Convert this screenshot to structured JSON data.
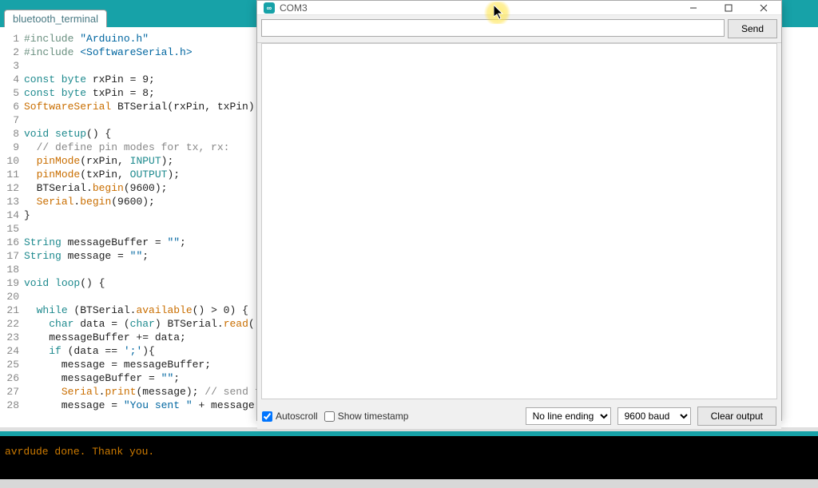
{
  "tab": {
    "name": "bluetooth_terminal"
  },
  "code": {
    "lines": [
      {
        "n": "1",
        "seg": [
          {
            "c": "tok-preproc",
            "t": "#include "
          },
          {
            "c": "tok-string",
            "t": "\"Arduino.h\""
          }
        ]
      },
      {
        "n": "2",
        "seg": [
          {
            "c": "tok-preproc",
            "t": "#include "
          },
          {
            "c": "tok-string",
            "t": "<SoftwareSerial.h>"
          }
        ]
      },
      {
        "n": "3",
        "seg": []
      },
      {
        "n": "4",
        "seg": [
          {
            "c": "tok-keyword",
            "t": "const byte"
          },
          {
            "c": "",
            "t": " rxPin = 9;"
          }
        ]
      },
      {
        "n": "5",
        "seg": [
          {
            "c": "tok-keyword",
            "t": "const byte"
          },
          {
            "c": "",
            "t": " txPin = 8;"
          }
        ]
      },
      {
        "n": "6",
        "seg": [
          {
            "c": "tok-orange",
            "t": "SoftwareSerial"
          },
          {
            "c": "",
            "t": " BTSerial(rxPin, txPin); //"
          }
        ]
      },
      {
        "n": "7",
        "seg": []
      },
      {
        "n": "8",
        "seg": [
          {
            "c": "tok-keyword",
            "t": "void "
          },
          {
            "c": "tok-keyword",
            "t": "setup"
          },
          {
            "c": "",
            "t": "() {"
          }
        ]
      },
      {
        "n": "9",
        "seg": [
          {
            "c": "",
            "t": "  "
          },
          {
            "c": "tok-comment",
            "t": "// define pin modes for tx, rx:"
          }
        ]
      },
      {
        "n": "10",
        "seg": [
          {
            "c": "",
            "t": "  "
          },
          {
            "c": "tok-orange",
            "t": "pinMode"
          },
          {
            "c": "",
            "t": "(rxPin, "
          },
          {
            "c": "tok-const",
            "t": "INPUT"
          },
          {
            "c": "",
            "t": ");"
          }
        ]
      },
      {
        "n": "11",
        "seg": [
          {
            "c": "",
            "t": "  "
          },
          {
            "c": "tok-orange",
            "t": "pinMode"
          },
          {
            "c": "",
            "t": "(txPin, "
          },
          {
            "c": "tok-const",
            "t": "OUTPUT"
          },
          {
            "c": "",
            "t": ");"
          }
        ]
      },
      {
        "n": "12",
        "seg": [
          {
            "c": "",
            "t": "  BTSerial."
          },
          {
            "c": "tok-orange",
            "t": "begin"
          },
          {
            "c": "",
            "t": "(9600);"
          }
        ]
      },
      {
        "n": "13",
        "seg": [
          {
            "c": "",
            "t": "  "
          },
          {
            "c": "tok-orange",
            "t": "Serial"
          },
          {
            "c": "",
            "t": "."
          },
          {
            "c": "tok-orange",
            "t": "begin"
          },
          {
            "c": "",
            "t": "(9600);"
          }
        ]
      },
      {
        "n": "14",
        "seg": [
          {
            "c": "",
            "t": "}"
          }
        ]
      },
      {
        "n": "15",
        "seg": []
      },
      {
        "n": "16",
        "seg": [
          {
            "c": "tok-keyword",
            "t": "String"
          },
          {
            "c": "",
            "t": " messageBuffer = "
          },
          {
            "c": "tok-string",
            "t": "\"\""
          },
          {
            "c": "",
            "t": ";"
          }
        ]
      },
      {
        "n": "17",
        "seg": [
          {
            "c": "tok-keyword",
            "t": "String"
          },
          {
            "c": "",
            "t": " message = "
          },
          {
            "c": "tok-string",
            "t": "\"\""
          },
          {
            "c": "",
            "t": ";"
          }
        ]
      },
      {
        "n": "18",
        "seg": []
      },
      {
        "n": "19",
        "seg": [
          {
            "c": "tok-keyword",
            "t": "void "
          },
          {
            "c": "tok-keyword",
            "t": "loop"
          },
          {
            "c": "",
            "t": "() {"
          }
        ]
      },
      {
        "n": "20",
        "seg": []
      },
      {
        "n": "21",
        "seg": [
          {
            "c": "",
            "t": "  "
          },
          {
            "c": "tok-keyword",
            "t": "while"
          },
          {
            "c": "",
            "t": " (BTSerial."
          },
          {
            "c": "tok-orange",
            "t": "available"
          },
          {
            "c": "",
            "t": "() > 0) {"
          }
        ]
      },
      {
        "n": "22",
        "seg": [
          {
            "c": "",
            "t": "    "
          },
          {
            "c": "tok-keyword",
            "t": "char"
          },
          {
            "c": "",
            "t": " data = ("
          },
          {
            "c": "tok-keyword",
            "t": "char"
          },
          {
            "c": "",
            "t": ") BTSerial."
          },
          {
            "c": "tok-orange",
            "t": "read"
          },
          {
            "c": "",
            "t": "();"
          }
        ]
      },
      {
        "n": "23",
        "seg": [
          {
            "c": "",
            "t": "    messageBuffer += data;"
          }
        ]
      },
      {
        "n": "24",
        "seg": [
          {
            "c": "",
            "t": "    "
          },
          {
            "c": "tok-keyword",
            "t": "if"
          },
          {
            "c": "",
            "t": " (data == "
          },
          {
            "c": "tok-string",
            "t": "';'"
          },
          {
            "c": "",
            "t": "){"
          }
        ]
      },
      {
        "n": "25",
        "seg": [
          {
            "c": "",
            "t": "      message = messageBuffer;"
          }
        ]
      },
      {
        "n": "26",
        "seg": [
          {
            "c": "",
            "t": "      messageBuffer = "
          },
          {
            "c": "tok-string",
            "t": "\"\""
          },
          {
            "c": "",
            "t": ";"
          }
        ]
      },
      {
        "n": "27",
        "seg": [
          {
            "c": "",
            "t": "      "
          },
          {
            "c": "tok-orange",
            "t": "Serial"
          },
          {
            "c": "",
            "t": "."
          },
          {
            "c": "tok-orange",
            "t": "print"
          },
          {
            "c": "",
            "t": "(message); "
          },
          {
            "c": "tok-comment",
            "t": "// send to se"
          }
        ]
      },
      {
        "n": "28",
        "seg": [
          {
            "c": "",
            "t": "      message = "
          },
          {
            "c": "tok-string",
            "t": "\"You sent \""
          },
          {
            "c": "",
            "t": " + message;"
          }
        ]
      }
    ]
  },
  "console": {
    "text": "avrdude done.  Thank you."
  },
  "monitor": {
    "title": "COM3",
    "send_label": "Send",
    "input_value": "",
    "autoscroll_label": "Autoscroll",
    "timestamp_label": "Show timestamp",
    "line_ending": "No line ending",
    "baud": "9600 baud",
    "clear_label": "Clear output",
    "autoscroll_checked": true,
    "timestamp_checked": false
  }
}
